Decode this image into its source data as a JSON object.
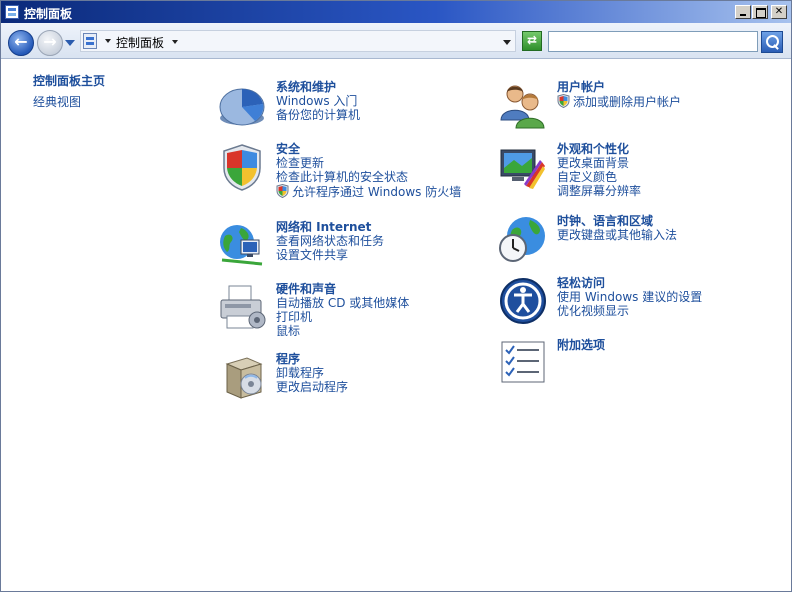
{
  "window": {
    "title": "控制面板",
    "min_label": "",
    "max_label": "",
    "close_label": "✕"
  },
  "address": {
    "back_glyph": "←",
    "forward_glyph": "→",
    "crumb": "控制面板",
    "refresh_glyph": "⇄",
    "search_value": ""
  },
  "sidebar": {
    "home": "控制面板主页",
    "classic": "经典视图"
  },
  "categories": [
    {
      "key": "system",
      "title": "系统和维护",
      "icon": "pie-chart-icon",
      "links": [
        "Windows 入门",
        "备份您的计算机"
      ]
    },
    {
      "key": "security",
      "title": "安全",
      "icon": "security-shield-icon",
      "links": [
        "检查更新",
        "检查此计算机的安全状态",
        "允许程序通过 Windows 防火墙"
      ]
    },
    {
      "key": "network",
      "title": "网络和 Internet",
      "icon": "network-globe-icon",
      "links": [
        "查看网络状态和任务",
        "设置文件共享"
      ]
    },
    {
      "key": "hardware",
      "title": "硬件和声音",
      "icon": "printer-icon",
      "links": [
        "自动播放 CD 或其他媒体",
        "打印机",
        "鼠标"
      ]
    },
    {
      "key": "programs",
      "title": "程序",
      "icon": "programs-box-icon",
      "links": [
        "卸载程序",
        "更改启动程序"
      ]
    },
    {
      "key": "users",
      "title": "用户帐户",
      "icon": "users-icon",
      "links": [
        "添加或删除用户帐户"
      ]
    },
    {
      "key": "appearance",
      "title": "外观和个性化",
      "icon": "monitor-color-icon",
      "links": [
        "更改桌面背景",
        "自定义颜色",
        "调整屏幕分辨率"
      ]
    },
    {
      "key": "clock",
      "title": "时钟、语言和区域",
      "icon": "clock-globe-icon",
      "links": [
        "更改键盘或其他输入法"
      ]
    },
    {
      "key": "ease",
      "title": "轻松访问",
      "icon": "ease-of-access-icon",
      "links": [
        "使用 Windows 建议的设置",
        "优化视频显示"
      ]
    },
    {
      "key": "addons",
      "title": "附加选项",
      "icon": "checklist-icon",
      "links": []
    }
  ]
}
